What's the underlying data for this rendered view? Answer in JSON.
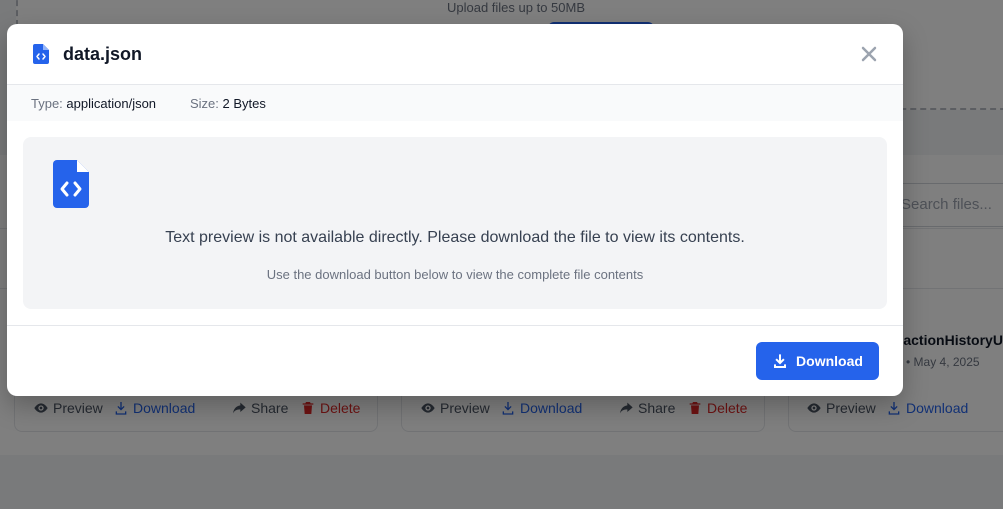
{
  "background": {
    "upload_hint": "Upload files up to 50MB",
    "search_placeholder": "Search files...",
    "file3": {
      "name": "TransactionHistoryUS",
      "date": "• May 4, 2025"
    },
    "actions": {
      "preview": "Preview",
      "download": "Download",
      "share": "Share",
      "delete": "Delete"
    }
  },
  "modal": {
    "title": "data.json",
    "type_label": "Type:",
    "type_value": "application/json",
    "size_label": "Size:",
    "size_value": "2 Bytes",
    "message": "Text preview is not available directly. Please download the file to view its contents.",
    "sub_message": "Use the download button below to view the complete file contents",
    "download_label": "Download"
  },
  "colors": {
    "primary": "#2563eb",
    "danger": "#dc2626",
    "overlay": "rgba(0,0,0,0.5)"
  }
}
